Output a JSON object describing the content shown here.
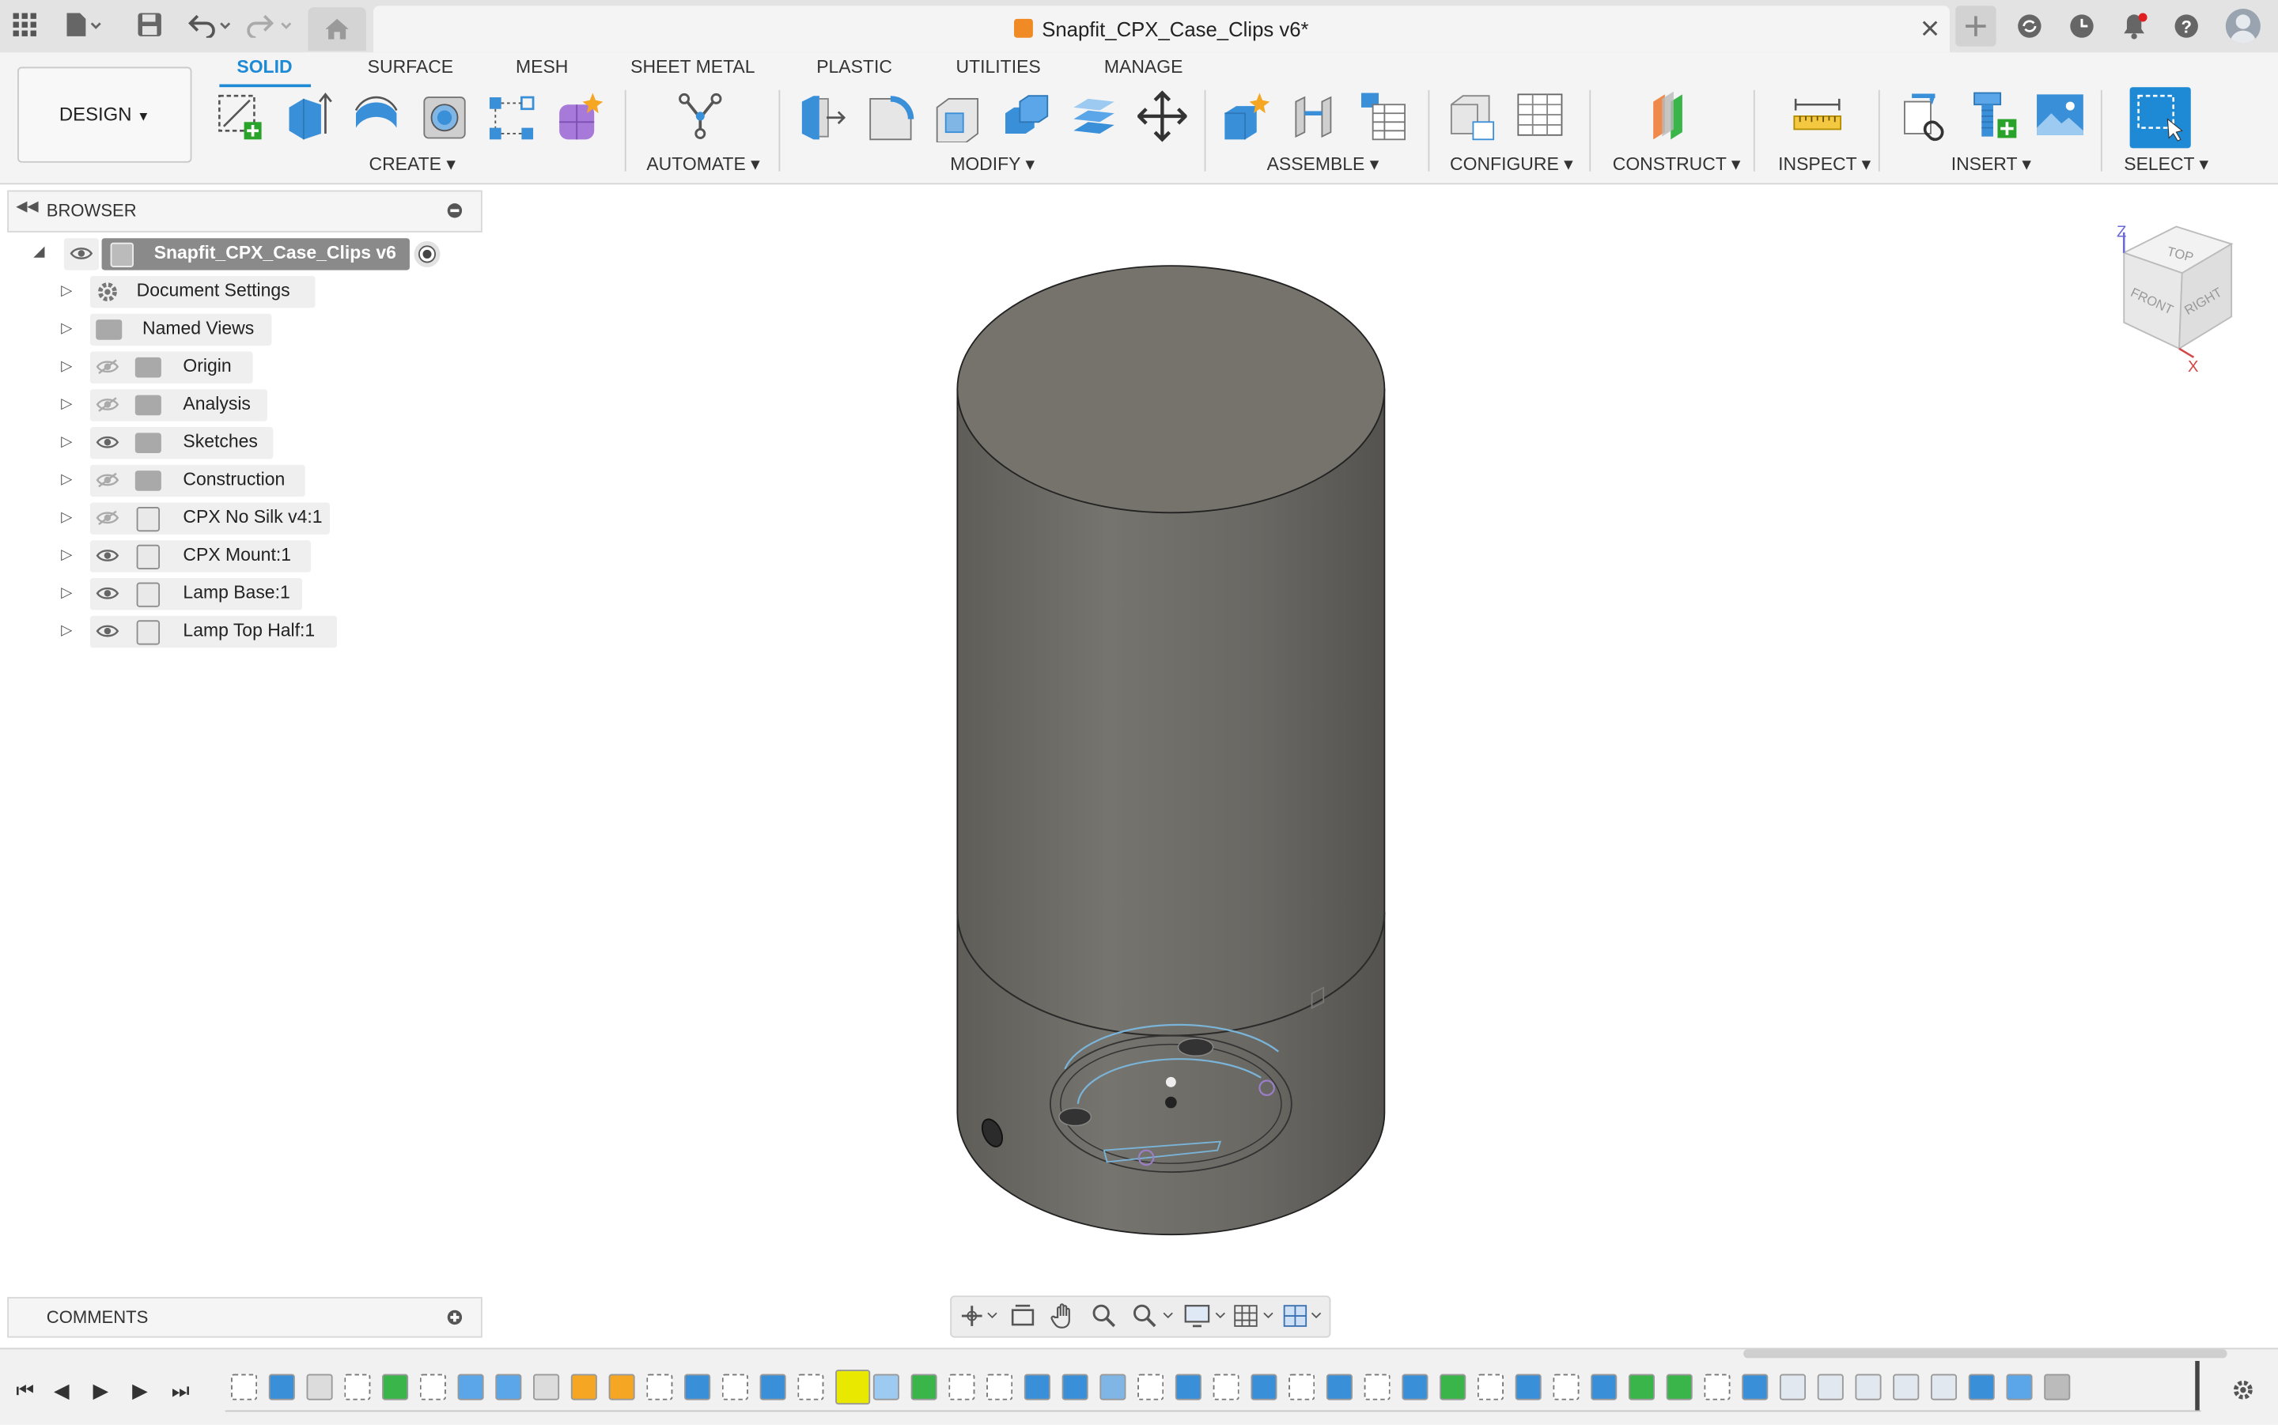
{
  "window": {
    "title": "Snapfit_CPX_Case_Clips v6*"
  },
  "ribbon": {
    "design_label": "DESIGN",
    "tabs": [
      {
        "label": "SOLID",
        "active": true
      },
      {
        "label": "SURFACE",
        "active": false
      },
      {
        "label": "MESH",
        "active": false
      },
      {
        "label": "SHEET METAL",
        "active": false
      },
      {
        "label": "PLASTIC",
        "active": false
      },
      {
        "label": "UTILITIES",
        "active": false
      },
      {
        "label": "MANAGE",
        "active": false
      }
    ],
    "groups": [
      {
        "label": "CREATE ▾"
      },
      {
        "label": "AUTOMATE ▾"
      },
      {
        "label": "MODIFY ▾"
      },
      {
        "label": "ASSEMBLE ▾"
      },
      {
        "label": "CONFIGURE ▾"
      },
      {
        "label": "CONSTRUCT ▾"
      },
      {
        "label": "INSPECT ▾"
      },
      {
        "label": "INSERT ▾"
      },
      {
        "label": "SELECT ▾"
      }
    ]
  },
  "browser": {
    "header": "BROWSER",
    "root": "Snapfit_CPX_Case_Clips v6",
    "items": [
      {
        "label": "Document Settings"
      },
      {
        "label": "Named Views"
      },
      {
        "label": "Origin"
      },
      {
        "label": "Analysis"
      },
      {
        "label": "Sketches"
      },
      {
        "label": "Construction"
      },
      {
        "label": "CPX No Silk v4:1"
      },
      {
        "label": "CPX Mount:1"
      },
      {
        "label": "Lamp Base:1"
      },
      {
        "label": "Lamp Top Half:1"
      }
    ]
  },
  "comments": {
    "label": "COMMENTS"
  },
  "viewcube": {
    "top": "TOP",
    "front": "FRONT",
    "right": "RIGHT",
    "axis_z": "Z",
    "axis_x": "X"
  },
  "colors": {
    "accent": "#1e8ad6",
    "model_body": "#6e6c66",
    "model_top": "#75736c",
    "app_icon": "#f08a24"
  }
}
